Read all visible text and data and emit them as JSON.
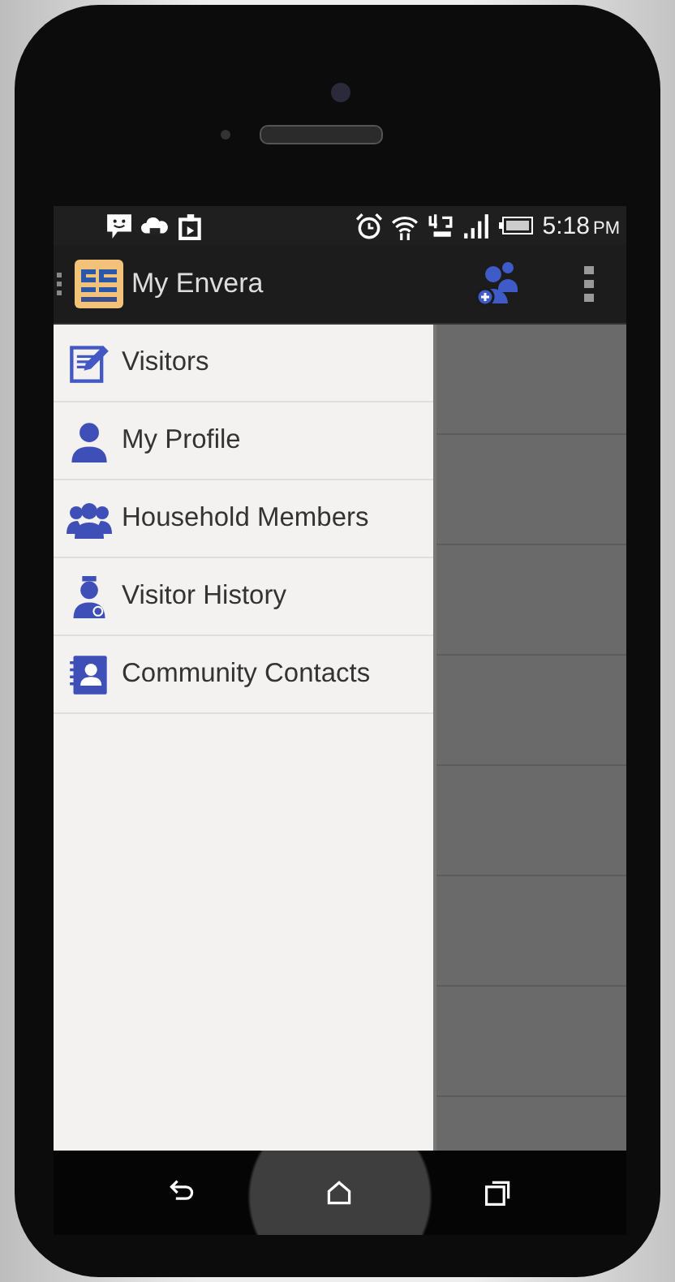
{
  "status_bar": {
    "time": "5:18",
    "period": "PM"
  },
  "app_bar": {
    "title": "My Envera"
  },
  "drawer": {
    "items": [
      {
        "label": "Visitors",
        "kind": "visitors"
      },
      {
        "label": "My Profile",
        "kind": "profile"
      },
      {
        "label": "Household Members",
        "kind": "household"
      },
      {
        "label": "Visitor History",
        "kind": "history"
      },
      {
        "label": "Community Contacts",
        "kind": "contacts"
      }
    ]
  }
}
